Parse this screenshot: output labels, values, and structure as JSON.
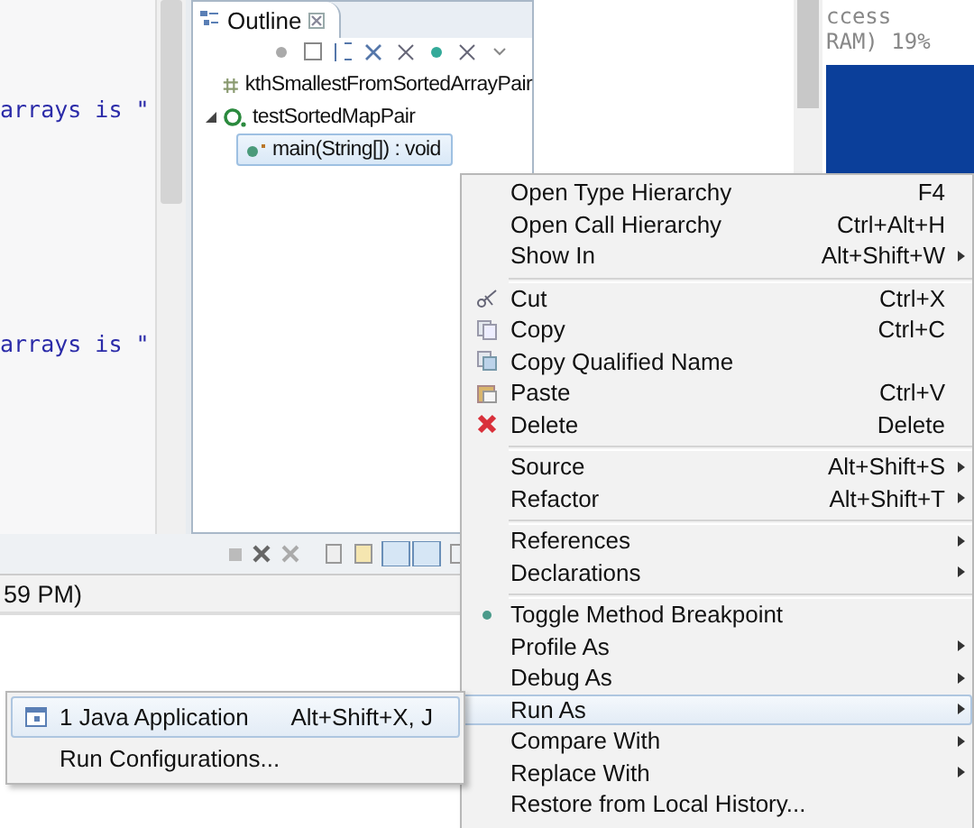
{
  "editor": {
    "code_lines": [
      "arrays is \"",
      "arrays is \""
    ]
  },
  "outline": {
    "title": "Outline",
    "tree": [
      {
        "label": "kthSmallestFromSortedArrayPair",
        "selected": false
      },
      {
        "label": "testSortedMapPair",
        "selected": false,
        "expanded": true,
        "children": [
          {
            "label": "main(String[]) : void",
            "selected": true
          }
        ]
      }
    ]
  },
  "background_window": {
    "lines": [
      "ccess",
      "RAM) 19%"
    ]
  },
  "console": {
    "tab_label": "59 PM)"
  },
  "context_menu": [
    {
      "kind": "item",
      "label": "Open Type Hierarchy",
      "shortcut": "F4",
      "submenu": false,
      "selected": false
    },
    {
      "kind": "item",
      "label": "Open Call Hierarchy",
      "shortcut": "Ctrl+Alt+H",
      "submenu": false,
      "selected": false
    },
    {
      "kind": "item",
      "label": "Show In",
      "shortcut": "Alt+Shift+W",
      "submenu": true,
      "selected": false
    },
    {
      "kind": "separator"
    },
    {
      "kind": "item",
      "label": "Cut",
      "shortcut": "Ctrl+X",
      "submenu": false,
      "selected": false
    },
    {
      "kind": "item",
      "label": "Copy",
      "shortcut": "Ctrl+C",
      "submenu": false,
      "selected": false
    },
    {
      "kind": "item",
      "label": "Copy Qualified Name",
      "submenu": false,
      "selected": false
    },
    {
      "kind": "item",
      "label": "Paste",
      "shortcut": "Ctrl+V",
      "submenu": false,
      "selected": false
    },
    {
      "kind": "item",
      "label": "Delete",
      "shortcut": "Delete",
      "submenu": false,
      "selected": false
    },
    {
      "kind": "separator"
    },
    {
      "kind": "item",
      "label": "Source",
      "shortcut": "Alt+Shift+S",
      "submenu": true,
      "selected": false
    },
    {
      "kind": "item",
      "label": "Refactor",
      "shortcut": "Alt+Shift+T",
      "submenu": true,
      "selected": false
    },
    {
      "kind": "separator"
    },
    {
      "kind": "item",
      "label": "References",
      "submenu": true,
      "selected": false
    },
    {
      "kind": "item",
      "label": "Declarations",
      "submenu": true,
      "selected": false
    },
    {
      "kind": "separator"
    },
    {
      "kind": "item",
      "label": "Toggle Method Breakpoint",
      "submenu": false,
      "selected": false
    },
    {
      "kind": "item",
      "label": "Profile As",
      "submenu": true,
      "selected": false
    },
    {
      "kind": "item",
      "label": "Debug As",
      "submenu": true,
      "selected": false
    },
    {
      "kind": "item",
      "label": "Run As",
      "submenu": true,
      "selected": true
    },
    {
      "kind": "item",
      "label": "Compare With",
      "submenu": true,
      "selected": false
    },
    {
      "kind": "item",
      "label": "Replace With",
      "submenu": true,
      "selected": false
    },
    {
      "kind": "item",
      "label": "Restore from Local History...",
      "submenu": false,
      "selected": false
    }
  ],
  "run_as_submenu": [
    {
      "label": "1 Java Application",
      "shortcut": "Alt+Shift+X, J",
      "selected": true
    },
    {
      "label": "Run Configurations...",
      "selected": false
    }
  ]
}
